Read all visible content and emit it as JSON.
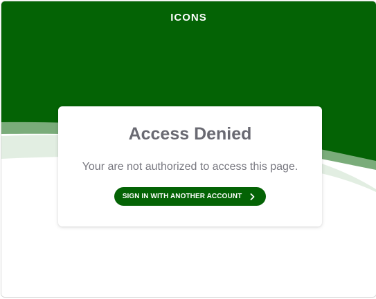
{
  "logo": {
    "text": "ICONS"
  },
  "card": {
    "title": "Access Denied",
    "message": "Your are not authorized to access this page.",
    "button_label": "SIGN IN WITH ANOTHER ACCOUNT",
    "button_icon": "chevron-right-icon"
  },
  "colors": {
    "brand_green": "#046305",
    "wave_mid": "#7aac7a",
    "wave_light": "#e2eee2",
    "title_gray": "#6a6a72"
  }
}
